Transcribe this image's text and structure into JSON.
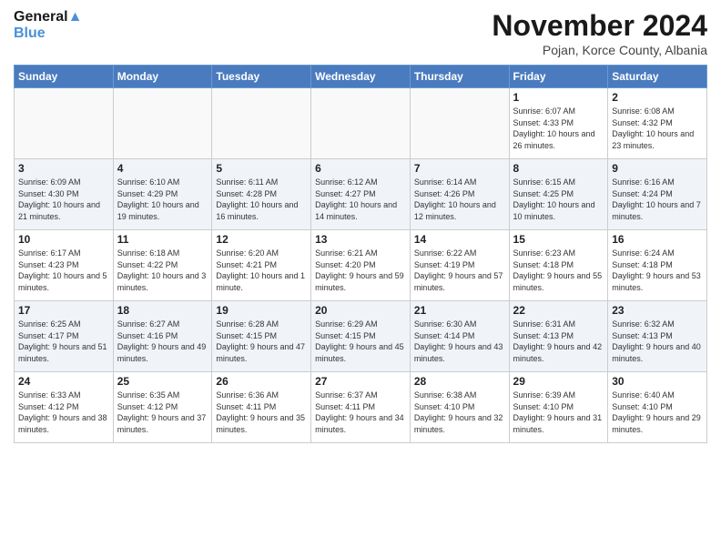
{
  "logo": {
    "line1": "General",
    "line2": "Blue"
  },
  "title": "November 2024",
  "location": "Pojan, Korce County, Albania",
  "days_of_week": [
    "Sunday",
    "Monday",
    "Tuesday",
    "Wednesday",
    "Thursday",
    "Friday",
    "Saturday"
  ],
  "weeks": [
    [
      {
        "day": "",
        "info": ""
      },
      {
        "day": "",
        "info": ""
      },
      {
        "day": "",
        "info": ""
      },
      {
        "day": "",
        "info": ""
      },
      {
        "day": "",
        "info": ""
      },
      {
        "day": "1",
        "info": "Sunrise: 6:07 AM\nSunset: 4:33 PM\nDaylight: 10 hours and 26 minutes."
      },
      {
        "day": "2",
        "info": "Sunrise: 6:08 AM\nSunset: 4:32 PM\nDaylight: 10 hours and 23 minutes."
      }
    ],
    [
      {
        "day": "3",
        "info": "Sunrise: 6:09 AM\nSunset: 4:30 PM\nDaylight: 10 hours and 21 minutes."
      },
      {
        "day": "4",
        "info": "Sunrise: 6:10 AM\nSunset: 4:29 PM\nDaylight: 10 hours and 19 minutes."
      },
      {
        "day": "5",
        "info": "Sunrise: 6:11 AM\nSunset: 4:28 PM\nDaylight: 10 hours and 16 minutes."
      },
      {
        "day": "6",
        "info": "Sunrise: 6:12 AM\nSunset: 4:27 PM\nDaylight: 10 hours and 14 minutes."
      },
      {
        "day": "7",
        "info": "Sunrise: 6:14 AM\nSunset: 4:26 PM\nDaylight: 10 hours and 12 minutes."
      },
      {
        "day": "8",
        "info": "Sunrise: 6:15 AM\nSunset: 4:25 PM\nDaylight: 10 hours and 10 minutes."
      },
      {
        "day": "9",
        "info": "Sunrise: 6:16 AM\nSunset: 4:24 PM\nDaylight: 10 hours and 7 minutes."
      }
    ],
    [
      {
        "day": "10",
        "info": "Sunrise: 6:17 AM\nSunset: 4:23 PM\nDaylight: 10 hours and 5 minutes."
      },
      {
        "day": "11",
        "info": "Sunrise: 6:18 AM\nSunset: 4:22 PM\nDaylight: 10 hours and 3 minutes."
      },
      {
        "day": "12",
        "info": "Sunrise: 6:20 AM\nSunset: 4:21 PM\nDaylight: 10 hours and 1 minute."
      },
      {
        "day": "13",
        "info": "Sunrise: 6:21 AM\nSunset: 4:20 PM\nDaylight: 9 hours and 59 minutes."
      },
      {
        "day": "14",
        "info": "Sunrise: 6:22 AM\nSunset: 4:19 PM\nDaylight: 9 hours and 57 minutes."
      },
      {
        "day": "15",
        "info": "Sunrise: 6:23 AM\nSunset: 4:18 PM\nDaylight: 9 hours and 55 minutes."
      },
      {
        "day": "16",
        "info": "Sunrise: 6:24 AM\nSunset: 4:18 PM\nDaylight: 9 hours and 53 minutes."
      }
    ],
    [
      {
        "day": "17",
        "info": "Sunrise: 6:25 AM\nSunset: 4:17 PM\nDaylight: 9 hours and 51 minutes."
      },
      {
        "day": "18",
        "info": "Sunrise: 6:27 AM\nSunset: 4:16 PM\nDaylight: 9 hours and 49 minutes."
      },
      {
        "day": "19",
        "info": "Sunrise: 6:28 AM\nSunset: 4:15 PM\nDaylight: 9 hours and 47 minutes."
      },
      {
        "day": "20",
        "info": "Sunrise: 6:29 AM\nSunset: 4:15 PM\nDaylight: 9 hours and 45 minutes."
      },
      {
        "day": "21",
        "info": "Sunrise: 6:30 AM\nSunset: 4:14 PM\nDaylight: 9 hours and 43 minutes."
      },
      {
        "day": "22",
        "info": "Sunrise: 6:31 AM\nSunset: 4:13 PM\nDaylight: 9 hours and 42 minutes."
      },
      {
        "day": "23",
        "info": "Sunrise: 6:32 AM\nSunset: 4:13 PM\nDaylight: 9 hours and 40 minutes."
      }
    ],
    [
      {
        "day": "24",
        "info": "Sunrise: 6:33 AM\nSunset: 4:12 PM\nDaylight: 9 hours and 38 minutes."
      },
      {
        "day": "25",
        "info": "Sunrise: 6:35 AM\nSunset: 4:12 PM\nDaylight: 9 hours and 37 minutes."
      },
      {
        "day": "26",
        "info": "Sunrise: 6:36 AM\nSunset: 4:11 PM\nDaylight: 9 hours and 35 minutes."
      },
      {
        "day": "27",
        "info": "Sunrise: 6:37 AM\nSunset: 4:11 PM\nDaylight: 9 hours and 34 minutes."
      },
      {
        "day": "28",
        "info": "Sunrise: 6:38 AM\nSunset: 4:10 PM\nDaylight: 9 hours and 32 minutes."
      },
      {
        "day": "29",
        "info": "Sunrise: 6:39 AM\nSunset: 4:10 PM\nDaylight: 9 hours and 31 minutes."
      },
      {
        "day": "30",
        "info": "Sunrise: 6:40 AM\nSunset: 4:10 PM\nDaylight: 9 hours and 29 minutes."
      }
    ]
  ]
}
